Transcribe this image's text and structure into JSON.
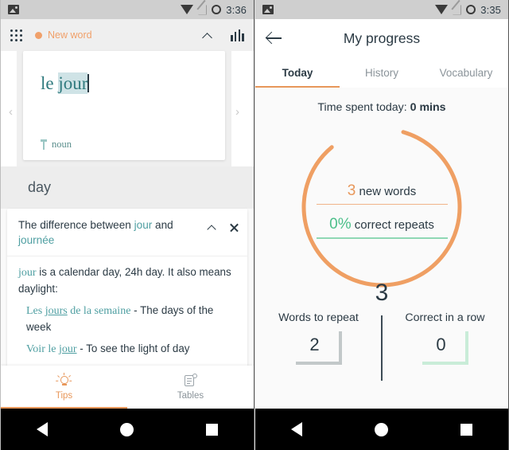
{
  "left": {
    "status_bar": {
      "time": "3:36",
      "icons": [
        "photo-icon",
        "wifi-icon",
        "no-signal-icon",
        "battery-icon"
      ]
    },
    "app_bar": {
      "grid_icon": "grid-menu-icon",
      "label": "New word",
      "collapse_icon": "chevron-up-icon",
      "stats_icon": "bar-chart-icon"
    },
    "card": {
      "prefix": "le ",
      "highlighted": "jour",
      "part_of_speech": "noun",
      "pos_icon": "gender-marker-icon",
      "prev_icon": "chevron-left-icon",
      "next_icon": "chevron-right-icon"
    },
    "translation": "day",
    "tips": {
      "title_pre": "The difference between ",
      "title_word1": "jour",
      "title_mid": " and ",
      "title_word2": "journée",
      "collapse_icon": "chevron-up-icon",
      "close_icon": "close-icon",
      "body_word": "jour",
      "body_text": " is a calendar day, 24h day. It also means daylight:",
      "examples": [
        {
          "fr_pre": "Les ",
          "fr_u": "jours",
          "fr_post": " de la semaine",
          "sep": " - ",
          "en": "The days of the week"
        },
        {
          "fr_pre": "Voir le ",
          "fr_u": "jour",
          "fr_post": "",
          "sep": " - ",
          "en": "To see the light of day"
        }
      ]
    },
    "bottom_tabs": [
      {
        "label": "Tips",
        "icon": "lightbulb-icon",
        "active": true
      },
      {
        "label": "Tables",
        "icon": "tables-icon",
        "active": false
      }
    ]
  },
  "right": {
    "status_bar": {
      "time": "3:35",
      "icons": [
        "photo-icon",
        "wifi-icon",
        "no-signal-icon",
        "battery-icon"
      ]
    },
    "app_bar": {
      "back_icon": "back-arrow-icon",
      "title": "My progress"
    },
    "tabs": [
      {
        "label": "Today",
        "active": true
      },
      {
        "label": "History",
        "active": false
      },
      {
        "label": "Vocabulary",
        "active": false
      }
    ],
    "time_spent_label": "Time spent today: ",
    "time_spent_value": "0 mins",
    "ring": {
      "new_words_value": "3",
      "new_words_label": " new words",
      "correct_repeats_value": "0%",
      "correct_repeats_label": " correct repeats",
      "center_total": "3"
    },
    "stats": [
      {
        "label": "Words to repeat",
        "value": "2",
        "accent": "#c2c8c9"
      },
      {
        "label": "Correct in a row",
        "value": "0",
        "accent": "#c9ecd8"
      }
    ]
  },
  "nav": {
    "back": "back-triangle-icon",
    "home": "home-circle-icon",
    "recents": "recents-square-icon"
  },
  "colors": {
    "orange": "#e8975a",
    "teal": "#4f9fa2",
    "green": "#4cbf8a",
    "dark": "#2b3a44"
  },
  "chart_data": {
    "type": "pie",
    "title": "Daily progress ring",
    "categories": [
      "new words",
      "correct repeats"
    ],
    "values": [
      3,
      0
    ],
    "center_label": "3",
    "legend": [
      "3 new words",
      "0% correct repeats"
    ]
  }
}
